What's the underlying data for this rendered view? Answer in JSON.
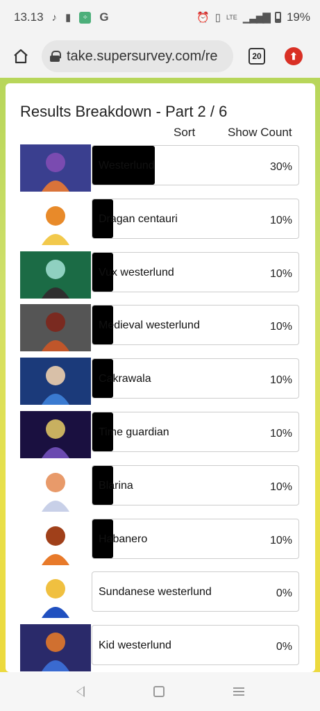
{
  "status_bar": {
    "time": "13.13",
    "battery": "19%",
    "signal": "LTE",
    "music_icon": "music-note-icon",
    "alert_icon": "alert-icon",
    "app_icon": "calculator-app-icon",
    "google_icon": "google-icon"
  },
  "browser": {
    "url": "take.supersurvey.com/re",
    "tab_count": "20"
  },
  "results": {
    "title": "Results Breakdown - Part 2 / 6",
    "sort_label": "Sort",
    "show_count_label": "Show Count",
    "options": [
      {
        "label": "Westerlund",
        "percent": "30%",
        "value": 30,
        "thumb_colors": [
          "#3a3f8f",
          "#d9733a",
          "#7a4bb0"
        ]
      },
      {
        "label": "Dragan centauri",
        "percent": "10%",
        "value": 10,
        "thumb_colors": [
          "#ffffff",
          "#f2c94c",
          "#e88a2a"
        ]
      },
      {
        "label": "Vux westerlund",
        "percent": "10%",
        "value": 10,
        "thumb_colors": [
          "#1b6b45",
          "#2f2f2f",
          "#8fd0c0"
        ]
      },
      {
        "label": "Medieval westerlund",
        "percent": "10%",
        "value": 10,
        "thumb_colors": [
          "#555555",
          "#c0562a",
          "#7a2a20"
        ]
      },
      {
        "label": "Cakrawala",
        "percent": "10%",
        "value": 10,
        "thumb_colors": [
          "#1b3a7a",
          "#3a7ad0",
          "#d8c0a8"
        ]
      },
      {
        "label": "Time guardian",
        "percent": "10%",
        "value": 10,
        "thumb_colors": [
          "#1a1040",
          "#6a4ab0",
          "#c8b060"
        ]
      },
      {
        "label": "Blarina",
        "percent": "10%",
        "value": 10,
        "thumb_colors": [
          "#ffffff",
          "#c8d0e8",
          "#e89a6a"
        ]
      },
      {
        "label": "Habanero",
        "percent": "10%",
        "value": 10,
        "thumb_colors": [
          "#ffffff",
          "#e87a2a",
          "#a0401a"
        ]
      },
      {
        "label": "Sundanese westerlund",
        "percent": "0%",
        "value": 0,
        "thumb_colors": [
          "#ffffff",
          "#2050c0",
          "#f0c040"
        ]
      },
      {
        "label": "Kid westerlund",
        "percent": "0%",
        "value": 0,
        "thumb_colors": [
          "#2a2a6a",
          "#3a6ad0",
          "#d07030"
        ]
      }
    ]
  },
  "colors": {
    "bar_fill": "#000000",
    "page_gradient_top": "#b7d65a",
    "page_gradient_bottom": "#ecd93e",
    "update_badge": "#d93025"
  }
}
